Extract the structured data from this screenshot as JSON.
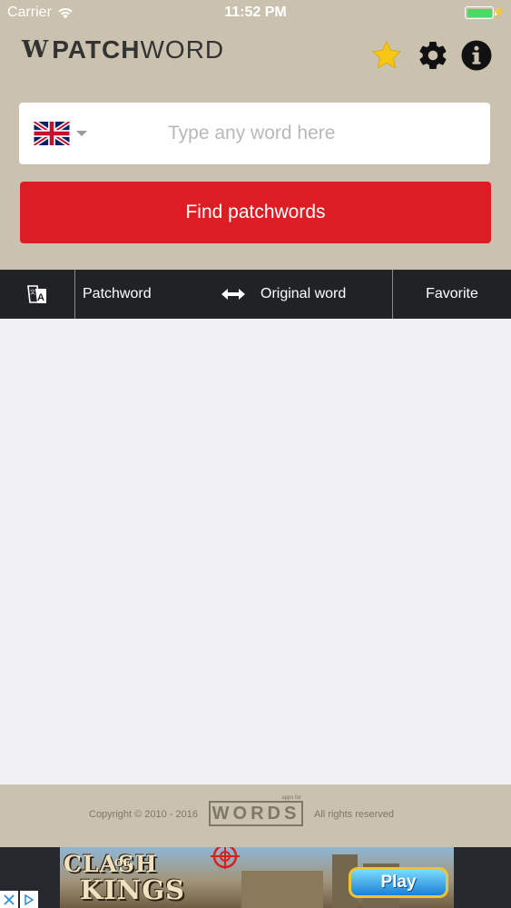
{
  "status_bar": {
    "carrier": "Carrier",
    "time": "11:52 PM",
    "battery_percent": 100
  },
  "header": {
    "logo_mark": "W",
    "logo_bold": "PATCH",
    "logo_light": "WORD",
    "icons": [
      "star-icon",
      "gear-icon",
      "info-icon"
    ]
  },
  "search": {
    "language_flag": "uk-flag-icon",
    "placeholder": "Type any word here",
    "value": ""
  },
  "find_button": {
    "label": "Find patchwords",
    "color": "#db1d24"
  },
  "columns": {
    "translate_icon": "translate-icon",
    "patchword": "Patchword",
    "swap_icon": "swap-arrows-icon",
    "original_word": "Original word",
    "favorite": "Favorite"
  },
  "footer": {
    "copyright": "Copyright © 2010 - 2016",
    "logo_text": "WORDS",
    "logo_tagline": "apps for",
    "rights": "All rights reserved"
  },
  "ad": {
    "title_line1": "CLASH",
    "title_of": "OF",
    "title_line2": "KINGS",
    "cta": "Play"
  },
  "colors": {
    "background_tan": "#cac2ae",
    "header_bar": "#202226",
    "accent_red": "#db1d24",
    "star_yellow": "#f5c518"
  }
}
